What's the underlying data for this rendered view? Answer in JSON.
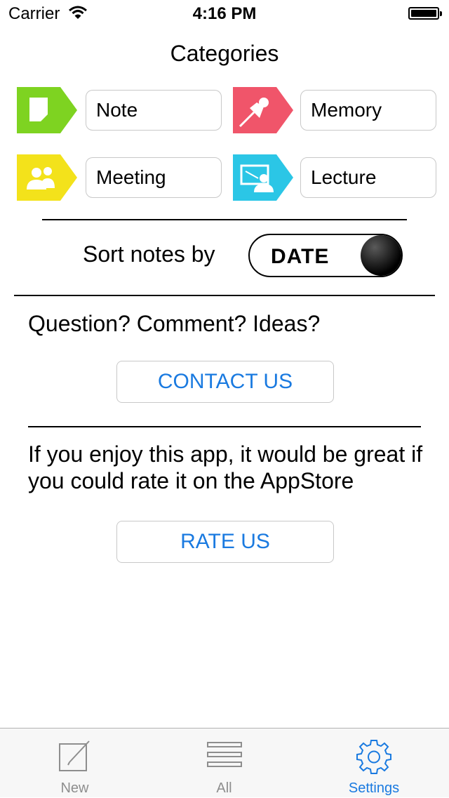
{
  "status_bar": {
    "carrier": "Carrier",
    "time": "4:16 PM"
  },
  "page": {
    "title": "Categories"
  },
  "categories": [
    {
      "name": "Note",
      "color": "#7ed321",
      "icon": "note-icon"
    },
    {
      "name": "Memory",
      "color": "#f0556a",
      "icon": "pushpin-icon"
    },
    {
      "name": "Meeting",
      "color": "#f3e21b",
      "icon": "people-icon"
    },
    {
      "name": "Lecture",
      "color": "#2bc6e6",
      "icon": "presentation-icon"
    }
  ],
  "sort": {
    "label": "Sort notes by",
    "value": "DATE"
  },
  "contact": {
    "question": "Question? Comment? Ideas?",
    "button": "CONTACT US"
  },
  "rate": {
    "text": "If you enjoy this app, it would be great if you could rate it on the AppStore",
    "button": "RATE US"
  },
  "tabs": [
    {
      "label": "New",
      "icon": "compose-icon",
      "selected": false
    },
    {
      "label": "All",
      "icon": "list-icon",
      "selected": false
    },
    {
      "label": "Settings",
      "icon": "gear-icon",
      "selected": true
    }
  ],
  "colors": {
    "accent": "#1a7ae0",
    "tab_inactive": "#8e8e8e"
  }
}
